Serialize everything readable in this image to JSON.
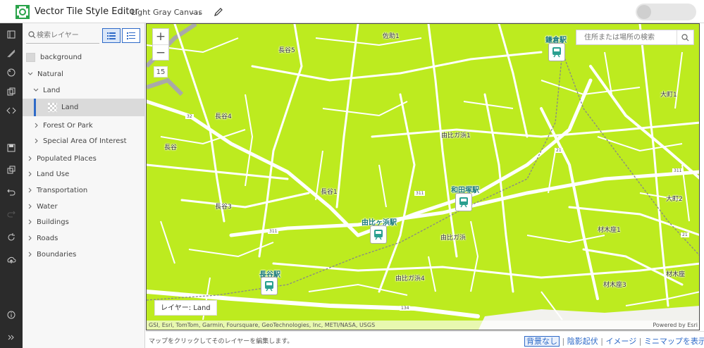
{
  "app": {
    "title": "Vector Tile Style Editor",
    "map_name": "Light Gray Canvas",
    "more_label": "...",
    "accent_color": "#2e6ac8",
    "land_color": "#bdeb1f"
  },
  "toolbar": {
    "icons": [
      "layers-icon",
      "style-icon",
      "palette-icon",
      "copy-style-icon",
      "code-icon",
      "save-icon",
      "duplicate-icon",
      "undo-icon",
      "redo-icon",
      "refresh-icon",
      "upload-icon",
      "info-icon",
      "expand-icon"
    ]
  },
  "panel": {
    "search_placeholder": "検索レイヤー",
    "tree": [
      {
        "id": "row-bg",
        "label": "background",
        "depth": 0,
        "kind": "swatch"
      },
      {
        "id": "row-natural",
        "label": "Natural",
        "depth": 0,
        "kind": "expanded"
      },
      {
        "id": "row-land",
        "label": "Land",
        "depth": 1,
        "kind": "expanded"
      },
      {
        "id": "row-land-leaf",
        "label": "Land",
        "depth": 2,
        "kind": "leaf",
        "selected": true
      },
      {
        "id": "row-forest",
        "label": "Forest Or Park",
        "depth": 1,
        "kind": "collapsed"
      },
      {
        "id": "row-special",
        "label": "Special Area Of Interest",
        "depth": 1,
        "kind": "collapsed"
      },
      {
        "id": "row-populated",
        "label": "Populated Places",
        "depth": 0,
        "kind": "collapsed"
      },
      {
        "id": "row-landuse",
        "label": "Land Use",
        "depth": 0,
        "kind": "collapsed"
      },
      {
        "id": "row-transport",
        "label": "Transportation",
        "depth": 0,
        "kind": "collapsed"
      },
      {
        "id": "row-water",
        "label": "Water",
        "depth": 0,
        "kind": "collapsed"
      },
      {
        "id": "row-buildings",
        "label": "Buildings",
        "depth": 0,
        "kind": "collapsed"
      },
      {
        "id": "row-roads",
        "label": "Roads",
        "depth": 0,
        "kind": "collapsed"
      },
      {
        "id": "row-boundaries",
        "label": "Boundaries",
        "depth": 0,
        "kind": "collapsed"
      }
    ]
  },
  "map": {
    "zoom_in": "+",
    "zoom_out": "−",
    "zoom_level": "15",
    "geo_search_placeholder": "住所または場所の検索",
    "layer_label": "レイヤー: Land",
    "attribution": "GSI, Esri, TomTom, Garmin, Foursquare, GeoTechnologies, Inc, METI/NASA, USGS",
    "powered_by": "Powered by Esri",
    "places": [
      {
        "text": "佐助1"
      },
      {
        "text": "長谷5"
      },
      {
        "text": "長谷4"
      },
      {
        "text": "長谷"
      },
      {
        "text": "大町1"
      },
      {
        "text": "由比ガ浜1"
      },
      {
        "text": "長谷1"
      },
      {
        "text": "長谷3"
      },
      {
        "text": "大町2"
      },
      {
        "text": "由比ガ浜"
      },
      {
        "text": "材木座1"
      },
      {
        "text": "由比ガ浜4"
      },
      {
        "text": "材木座3"
      },
      {
        "text": "材木座"
      }
    ],
    "stations": [
      {
        "name": "鎌倉駅"
      },
      {
        "name": "和田塚駅"
      },
      {
        "name": "由比ヶ浜駅"
      },
      {
        "name": "長谷駅"
      }
    ],
    "routes": [
      "32",
      "311",
      "21",
      "311",
      "311",
      "21",
      "134"
    ]
  },
  "bottom": {
    "hint": "マップをクリックしてそのレイヤーを編集します。",
    "links": [
      "背景なし",
      "陰影起伏",
      "イメージ",
      "ミニマップを表示"
    ]
  }
}
